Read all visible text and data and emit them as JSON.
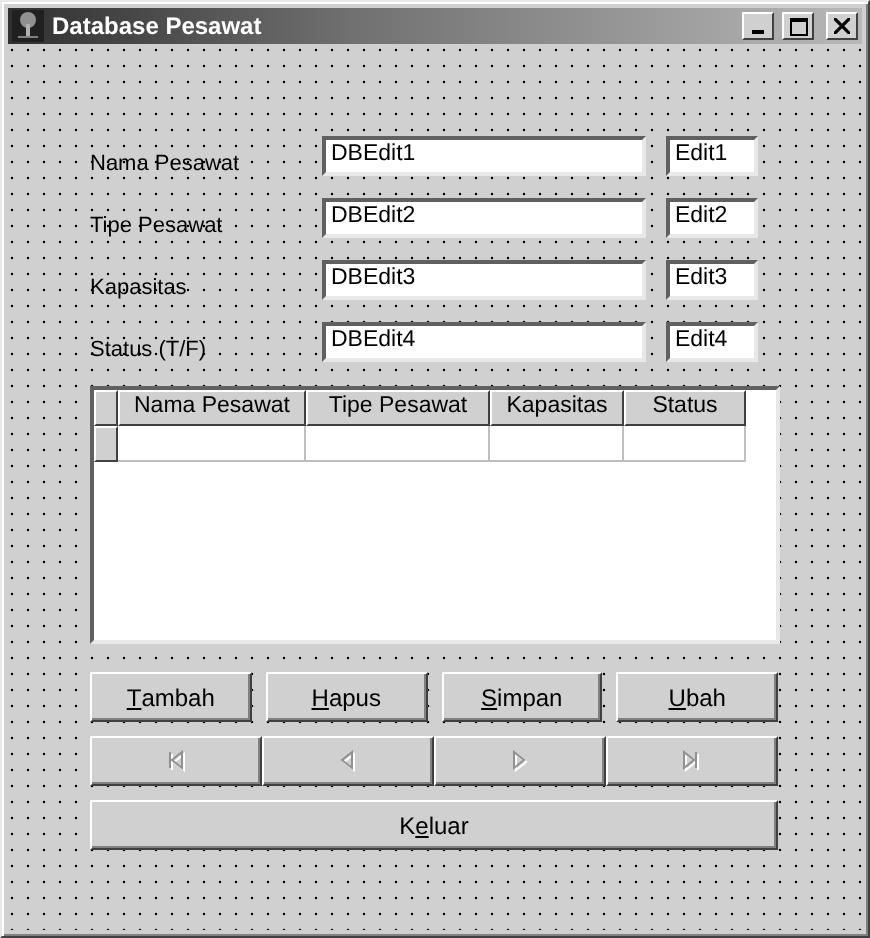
{
  "window": {
    "title": "Database Pesawat",
    "controls": [
      {
        "kind": "minimize"
      },
      {
        "kind": "maximize"
      },
      {
        "kind": "close"
      }
    ]
  },
  "fields": [
    {
      "label": "Nama Pesawat",
      "db_value": "DBEdit1",
      "value": "Edit1"
    },
    {
      "label": "Tipe Pesawat",
      "db_value": "DBEdit2",
      "value": "Edit2"
    },
    {
      "label": "Kapasitas",
      "db_value": "DBEdit3",
      "value": "Edit3"
    },
    {
      "label": "Status (T/F)",
      "db_value": "DBEdit4",
      "value": "Edit4"
    }
  ],
  "grid": {
    "columns": [
      "Nama Pesawat",
      "Tipe Pesawat",
      "Kapasitas",
      "Status"
    ]
  },
  "buttons": [
    {
      "key": "T",
      "post": "ambah"
    },
    {
      "key": "H",
      "post": "apus"
    },
    {
      "key": "S",
      "post": "impan"
    },
    {
      "key": "U",
      "post": "bah"
    }
  ],
  "navigator": [
    {
      "kind": "first",
      "disabled": true
    },
    {
      "kind": "prior",
      "disabled": true
    },
    {
      "kind": "next",
      "disabled": true
    },
    {
      "kind": "last",
      "disabled": true
    }
  ],
  "exit_button": {
    "pre": "K",
    "key": "e",
    "post": "luar"
  }
}
